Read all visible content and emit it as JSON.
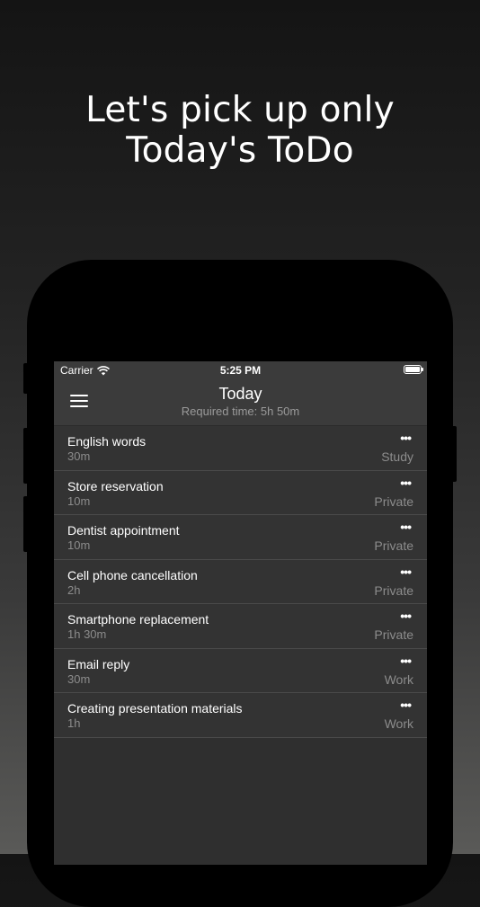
{
  "headline": {
    "line1": "Let's pick up only",
    "line2": "Today's ToDo"
  },
  "status_bar": {
    "carrier": "Carrier",
    "time": "5:25 PM"
  },
  "nav": {
    "title": "Today",
    "subtitle": "Required time: 5h 50m"
  },
  "more_label": "•••",
  "tasks": [
    {
      "title": "English words",
      "duration": "30m",
      "category": "Study"
    },
    {
      "title": "Store reservation",
      "duration": "10m",
      "category": "Private"
    },
    {
      "title": "Dentist appointment",
      "duration": "10m",
      "category": "Private"
    },
    {
      "title": "Cell phone cancellation",
      "duration": "2h",
      "category": "Private"
    },
    {
      "title": "Smartphone replacement",
      "duration": "1h 30m",
      "category": "Private"
    },
    {
      "title": "Email reply",
      "duration": "30m",
      "category": "Work"
    },
    {
      "title": "Creating presentation materials",
      "duration": "1h",
      "category": "Work"
    }
  ]
}
